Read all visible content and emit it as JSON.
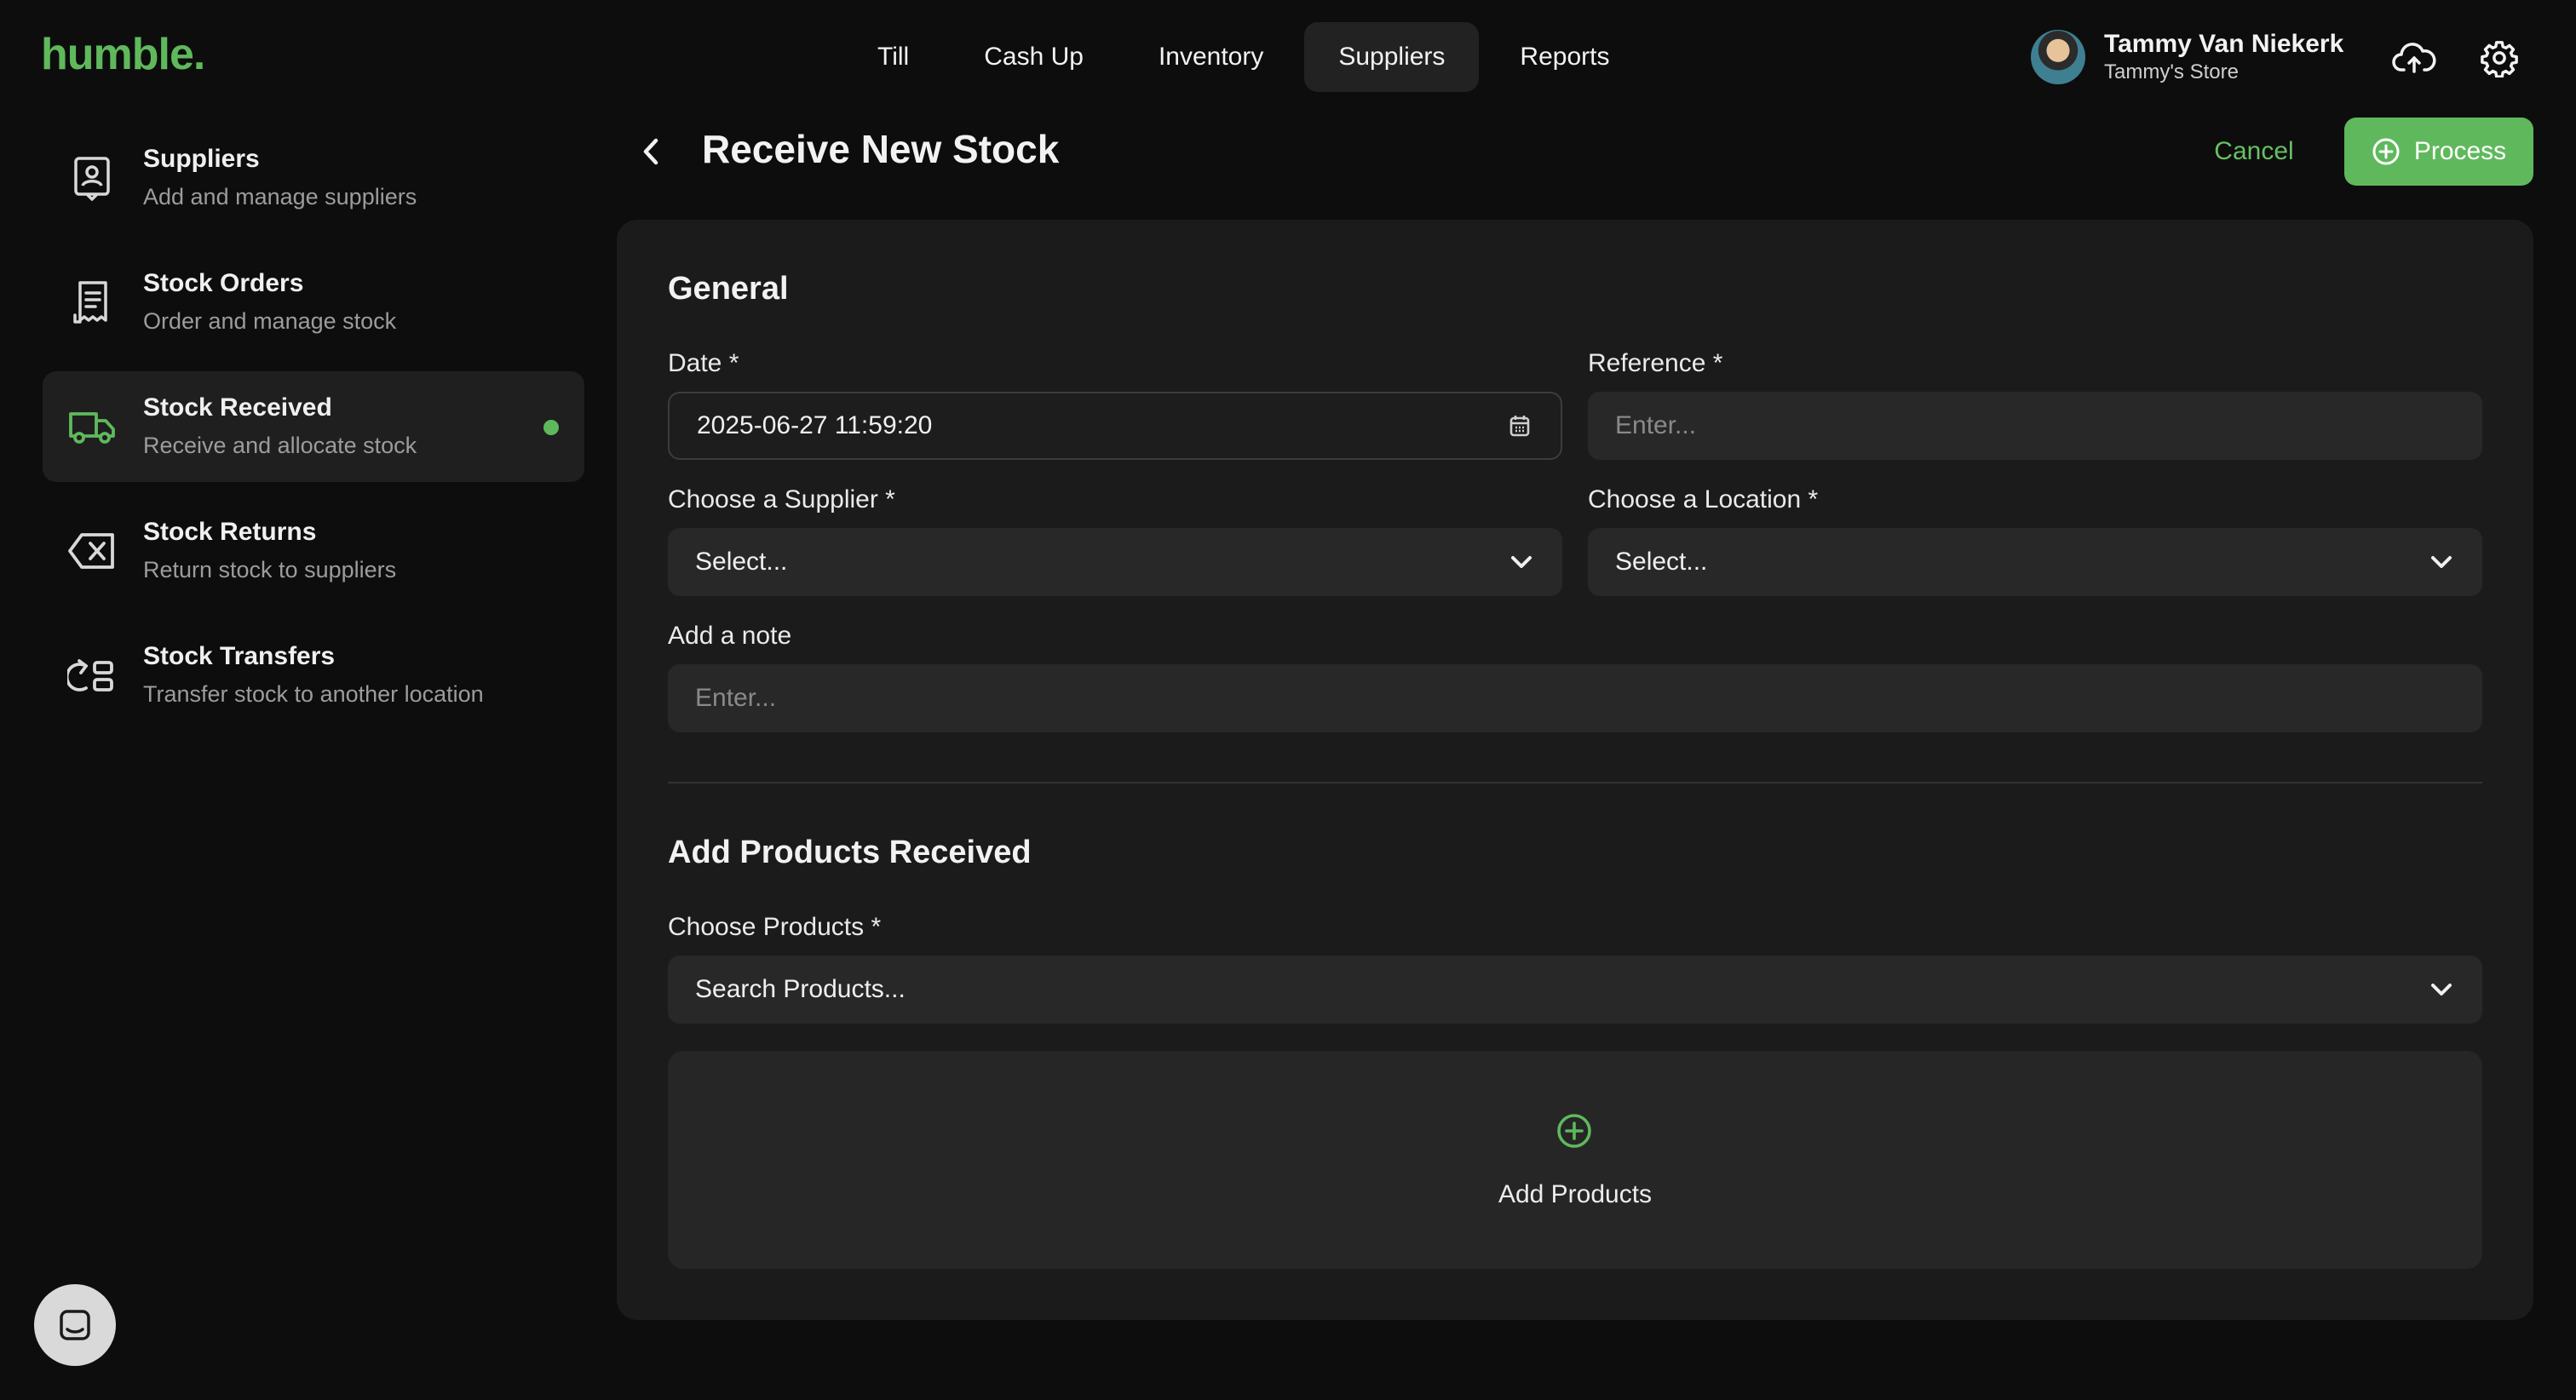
{
  "app": {
    "logo": "humble.",
    "nav": [
      "Till",
      "Cash Up",
      "Inventory",
      "Suppliers",
      "Reports"
    ],
    "active_nav": "Suppliers",
    "user": {
      "name": "Tammy Van Niekerk",
      "store": "Tammy's Store"
    },
    "icons": [
      "cloud-upload-icon",
      "gear-icon"
    ]
  },
  "sidebar": {
    "items": [
      {
        "title": "Suppliers",
        "subtitle": "Add and manage suppliers",
        "icon": "supplier-badge-icon"
      },
      {
        "title": "Stock Orders",
        "subtitle": "Order and manage stock",
        "icon": "receipt-icon"
      },
      {
        "title": "Stock Received",
        "subtitle": "Receive and allocate stock",
        "icon": "truck-icon",
        "active": true
      },
      {
        "title": "Stock Returns",
        "subtitle": "Return stock to suppliers",
        "icon": "backspace-x-icon"
      },
      {
        "title": "Stock Transfers",
        "subtitle": "Transfer stock to another location",
        "icon": "transfer-icon"
      }
    ]
  },
  "page": {
    "title": "Receive New Stock",
    "cancel_label": "Cancel",
    "process_label": "Process"
  },
  "general": {
    "heading": "General",
    "date_label": "Date *",
    "date_value": "2025-06-27 11:59:20",
    "reference_label": "Reference *",
    "reference_placeholder": "Enter...",
    "supplier_label": "Choose a Supplier *",
    "supplier_value": "Select...",
    "location_label": "Choose a Location *",
    "location_value": "Select...",
    "note_label": "Add a note",
    "note_placeholder": "Enter..."
  },
  "products": {
    "heading": "Add Products Received",
    "choose_label": "Choose Products *",
    "search_placeholder": "Search Products...",
    "add_label": "Add Products"
  },
  "colors": {
    "accent": "#5fb95c",
    "background": "#0d0d0d",
    "card": "#1b1b1b",
    "field": "#282828"
  }
}
